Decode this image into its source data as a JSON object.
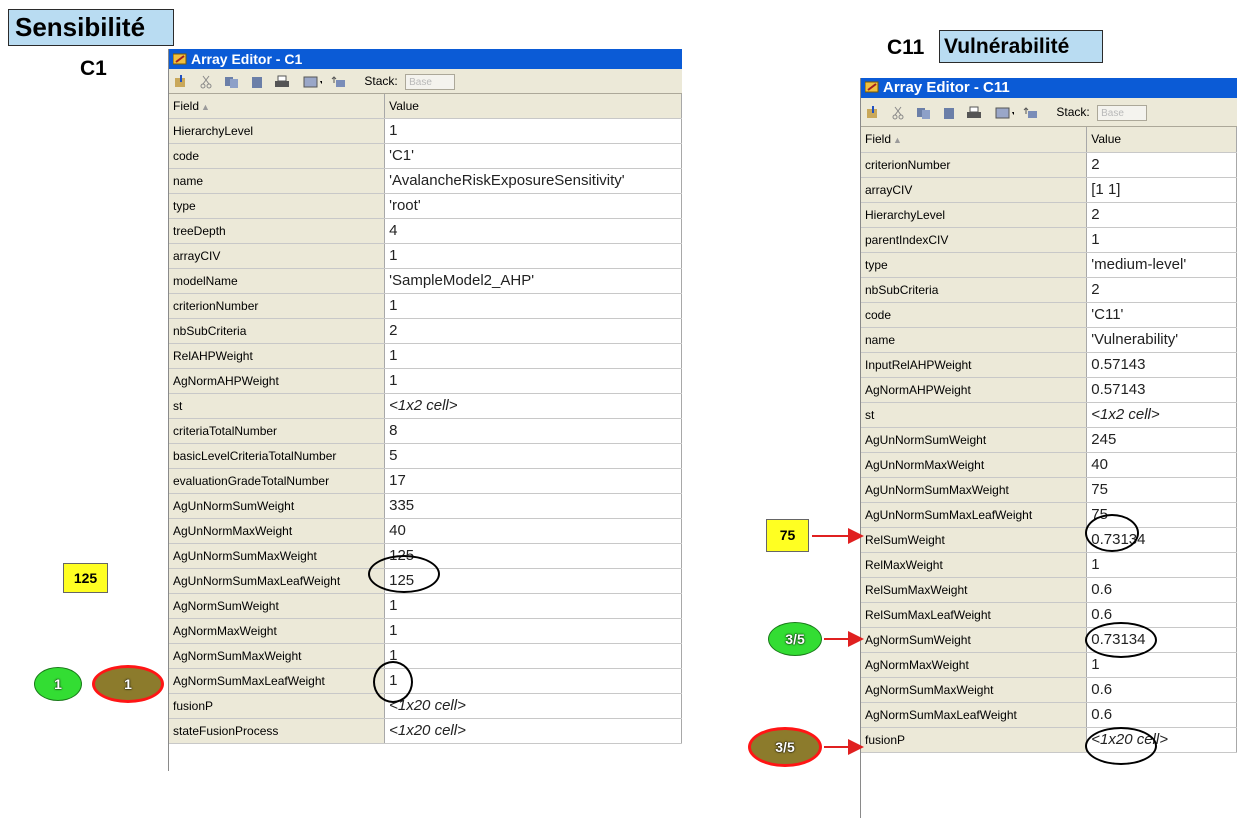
{
  "left": {
    "section_title": "Sensibilité",
    "code_label": "C1",
    "window_title": "Array Editor - C1",
    "toolbar": {
      "stack_label": "Stack:",
      "stack_value": "Base"
    },
    "columns": {
      "field": "Field",
      "value": "Value"
    },
    "rows": [
      {
        "field": "HierarchyLevel",
        "value": "1"
      },
      {
        "field": "code",
        "value": "'C1'"
      },
      {
        "field": "name",
        "value": "'AvalancheRiskExposureSensitivity'"
      },
      {
        "field": "type",
        "value": "'root'"
      },
      {
        "field": "treeDepth",
        "value": "4"
      },
      {
        "field": "arrayCIV",
        "value": "1"
      },
      {
        "field": "modelName",
        "value": "'SampleModel2_AHP'"
      },
      {
        "field": "criterionNumber",
        "value": "1"
      },
      {
        "field": "nbSubCriteria",
        "value": "2"
      },
      {
        "field": "RelAHPWeight",
        "value": "1"
      },
      {
        "field": "AgNormAHPWeight",
        "value": "1"
      },
      {
        "field": "st",
        "value": "<1x2 cell>"
      },
      {
        "field": "criteriaTotalNumber",
        "value": "8"
      },
      {
        "field": "basicLevelCriteriaTotalNumber",
        "value": "5"
      },
      {
        "field": "evaluationGradeTotalNumber",
        "value": "17"
      },
      {
        "field": "AgUnNormSumWeight",
        "value": "335"
      },
      {
        "field": "AgUnNormMaxWeight",
        "value": "40"
      },
      {
        "field": "AgUnNormSumMaxWeight",
        "value": "125"
      },
      {
        "field": "AgUnNormSumMaxLeafWeight",
        "value": "125"
      },
      {
        "field": "AgNormSumWeight",
        "value": "1"
      },
      {
        "field": "AgNormMaxWeight",
        "value": "1"
      },
      {
        "field": "AgNormSumMaxWeight",
        "value": "1"
      },
      {
        "field": "AgNormSumMaxLeafWeight",
        "value": "1"
      },
      {
        "field": "fusionP",
        "value": "<1x20 cell>"
      },
      {
        "field": "stateFusionProcess",
        "value": "<1x20 cell>"
      }
    ],
    "annotations": {
      "yellow_box": "125",
      "green_ellipse": "1",
      "olive_ellipse": "1"
    }
  },
  "right": {
    "code_label": "C11",
    "section_title": "Vulnérabilité",
    "window_title": "Array Editor - C11",
    "toolbar": {
      "stack_label": "Stack:",
      "stack_value": "Base"
    },
    "columns": {
      "field": "Field",
      "value": "Value"
    },
    "rows": [
      {
        "field": "criterionNumber",
        "value": "2"
      },
      {
        "field": "arrayCIV",
        "value": "[1 1]"
      },
      {
        "field": "HierarchyLevel",
        "value": "2"
      },
      {
        "field": "parentIndexCIV",
        "value": "1"
      },
      {
        "field": "type",
        "value": "'medium-level'"
      },
      {
        "field": "nbSubCriteria",
        "value": "2"
      },
      {
        "field": "code",
        "value": "'C11'"
      },
      {
        "field": "name",
        "value": "'Vulnerability'"
      },
      {
        "field": "InputRelAHPWeight",
        "value": "0.57143"
      },
      {
        "field": "AgNormAHPWeight",
        "value": "0.57143"
      },
      {
        "field": "st",
        "value": "<1x2 cell>"
      },
      {
        "field": "AgUnNormSumWeight",
        "value": "245"
      },
      {
        "field": "AgUnNormMaxWeight",
        "value": "40"
      },
      {
        "field": "AgUnNormSumMaxWeight",
        "value": "75"
      },
      {
        "field": "AgUnNormSumMaxLeafWeight",
        "value": "75"
      },
      {
        "field": "RelSumWeight",
        "value": "0.73134"
      },
      {
        "field": "RelMaxWeight",
        "value": "1"
      },
      {
        "field": "RelSumMaxWeight",
        "value": "0.6"
      },
      {
        "field": "RelSumMaxLeafWeight",
        "value": "0.6"
      },
      {
        "field": "AgNormSumWeight",
        "value": "0.73134"
      },
      {
        "field": "AgNormMaxWeight",
        "value": "1"
      },
      {
        "field": "AgNormSumMaxWeight",
        "value": "0.6"
      },
      {
        "field": "AgNormSumMaxLeafWeight",
        "value": "0.6"
      },
      {
        "field": "fusionP",
        "value": "<1x20 cell>"
      }
    ],
    "annotations": {
      "yellow_box": "75",
      "green_ellipse": "3/5",
      "olive_ellipse": "3/5"
    }
  },
  "colors": {
    "header_box": "#b9dcf2",
    "title_bar": "#0b5bd6",
    "yellow": "#ffff22",
    "green": "#33dd33",
    "olive": "#8c7b2c",
    "arrow_red": "#e02020"
  }
}
